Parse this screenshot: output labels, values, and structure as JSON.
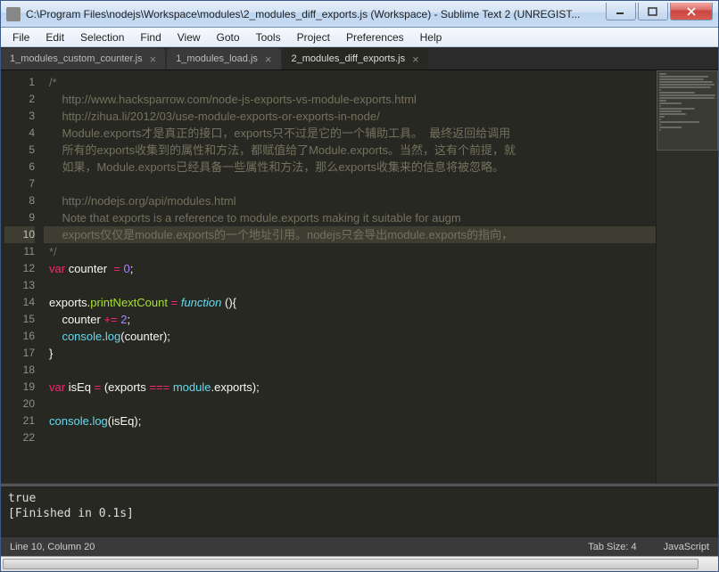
{
  "window": {
    "title": "C:\\Program Files\\nodejs\\Workspace\\modules\\2_modules_diff_exports.js (Workspace) - Sublime Text 2 (UNREGIST..."
  },
  "menu": [
    "File",
    "Edit",
    "Selection",
    "Find",
    "View",
    "Goto",
    "Tools",
    "Project",
    "Preferences",
    "Help"
  ],
  "tabs": [
    {
      "label": "1_modules_custom_counter.js",
      "active": false,
      "dirty": false
    },
    {
      "label": "1_modules_load.js",
      "active": false,
      "dirty": false
    },
    {
      "label": "2_modules_diff_exports.js",
      "active": true,
      "dirty": false
    }
  ],
  "code_lines": [
    {
      "n": 1,
      "tokens": [
        {
          "t": "/*",
          "c": "c-comment"
        }
      ]
    },
    {
      "n": 2,
      "tokens": [
        {
          "t": "    http://www.hacksparrow.com/node-js-exports-vs-module-exports.html",
          "c": "c-comment"
        }
      ]
    },
    {
      "n": 3,
      "tokens": [
        {
          "t": "    http://zihua.li/2012/03/use-module-exports-or-exports-in-node/",
          "c": "c-comment"
        }
      ]
    },
    {
      "n": 4,
      "tokens": [
        {
          "t": "    Module.exports才是真正的接口，exports只不过是它的一个辅助工具。  最终返回给调用",
          "c": "c-comment"
        }
      ]
    },
    {
      "n": 5,
      "tokens": [
        {
          "t": "    所有的exports收集到的属性和方法，都赋值给了Module.exports。当然，这有个前提，就",
          "c": "c-comment"
        }
      ]
    },
    {
      "n": 6,
      "tokens": [
        {
          "t": "    如果，Module.exports已经具备一些属性和方法，那么exports收集来的信息将被忽略。",
          "c": "c-comment"
        }
      ]
    },
    {
      "n": 7,
      "tokens": [
        {
          "t": "",
          "c": "c-comment"
        }
      ]
    },
    {
      "n": 8,
      "tokens": [
        {
          "t": "    http://nodejs.org/api/modules.html",
          "c": "c-comment"
        }
      ]
    },
    {
      "n": 9,
      "tokens": [
        {
          "t": "    Note that exports is a reference to module.exports making it suitable for augm",
          "c": "c-comment"
        }
      ]
    },
    {
      "n": 10,
      "hl": true,
      "tokens": [
        {
          "t": "    exports仅仅是module.exports的一个地址引用。nodejs只会导出module.exports的指向，",
          "c": "c-comment"
        }
      ]
    },
    {
      "n": 11,
      "tokens": [
        {
          "t": "*/",
          "c": "c-comment"
        }
      ]
    },
    {
      "n": 12,
      "tokens": [
        {
          "t": "var",
          "c": "c-storage"
        },
        {
          "t": " "
        },
        {
          "t": "counter",
          "c": "c-name"
        },
        {
          "t": "  "
        },
        {
          "t": "=",
          "c": "c-op"
        },
        {
          "t": " "
        },
        {
          "t": "0",
          "c": "c-num"
        },
        {
          "t": ";"
        }
      ]
    },
    {
      "n": 13,
      "tokens": [
        {
          "t": ""
        }
      ]
    },
    {
      "n": 14,
      "tokens": [
        {
          "t": "exports",
          "c": "c-name"
        },
        {
          "t": "."
        },
        {
          "t": "printNextCount",
          "c": "c-func"
        },
        {
          "t": " "
        },
        {
          "t": "=",
          "c": "c-op"
        },
        {
          "t": " "
        },
        {
          "t": "function",
          "c": "c-keyword"
        },
        {
          "t": " (){"
        }
      ]
    },
    {
      "n": 15,
      "tokens": [
        {
          "t": "    counter ",
          "c": "c-name"
        },
        {
          "t": "+=",
          "c": "c-op"
        },
        {
          "t": " "
        },
        {
          "t": "2",
          "c": "c-num"
        },
        {
          "t": ";"
        }
      ]
    },
    {
      "n": 16,
      "tokens": [
        {
          "t": "    "
        },
        {
          "t": "console",
          "c": "c-support"
        },
        {
          "t": "."
        },
        {
          "t": "log",
          "c": "c-support"
        },
        {
          "t": "(counter);"
        }
      ]
    },
    {
      "n": 17,
      "tokens": [
        {
          "t": "}"
        }
      ]
    },
    {
      "n": 18,
      "tokens": [
        {
          "t": ""
        }
      ]
    },
    {
      "n": 19,
      "tokens": [
        {
          "t": "var",
          "c": "c-storage"
        },
        {
          "t": " "
        },
        {
          "t": "isEq",
          "c": "c-name"
        },
        {
          "t": " "
        },
        {
          "t": "=",
          "c": "c-op"
        },
        {
          "t": " ("
        },
        {
          "t": "exports",
          "c": "c-name"
        },
        {
          "t": " "
        },
        {
          "t": "===",
          "c": "c-op"
        },
        {
          "t": " "
        },
        {
          "t": "module",
          "c": "c-support"
        },
        {
          "t": "."
        },
        {
          "t": "exports",
          "c": "c-name"
        },
        {
          "t": ");"
        }
      ]
    },
    {
      "n": 20,
      "tokens": [
        {
          "t": ""
        }
      ]
    },
    {
      "n": 21,
      "tokens": [
        {
          "t": "console",
          "c": "c-support"
        },
        {
          "t": "."
        },
        {
          "t": "log",
          "c": "c-support"
        },
        {
          "t": "(isEq);"
        }
      ]
    },
    {
      "n": 22,
      "tokens": [
        {
          "t": ""
        }
      ]
    }
  ],
  "console_output": "true\n[Finished in 0.1s]",
  "status": {
    "position": "Line 10, Column 20",
    "tab_size": "Tab Size: 4",
    "syntax": "JavaScript"
  },
  "chart_data": null
}
